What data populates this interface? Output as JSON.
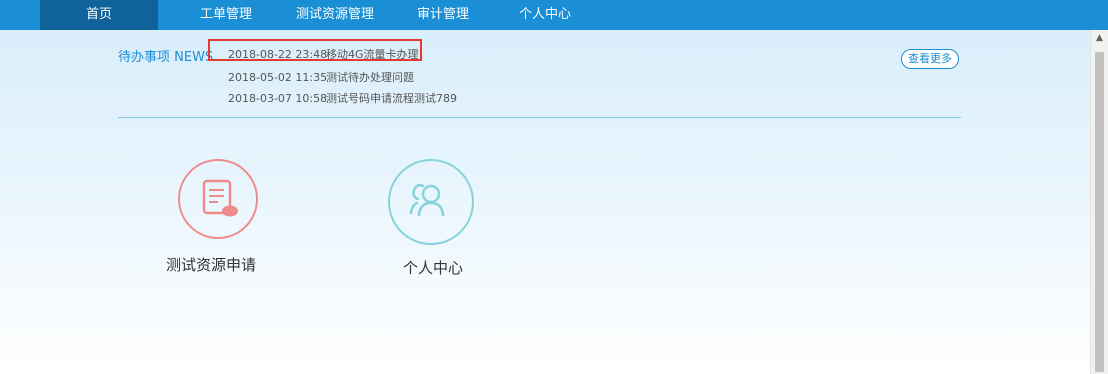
{
  "nav": {
    "items": [
      {
        "label": "首页",
        "active": true
      },
      {
        "label": "工单管理",
        "active": false
      },
      {
        "label": "测试资源管理",
        "active": false
      },
      {
        "label": "审计管理",
        "active": false
      },
      {
        "label": "个人中心",
        "active": false
      }
    ]
  },
  "news": {
    "title": "待办事项 NEWS",
    "items": [
      {
        "date": "2018-08-22 23:48",
        "text": "移动4G流量卡办理"
      },
      {
        "date": "2018-05-02 11:35",
        "text": "测试待办处理问题"
      },
      {
        "date": "2018-03-07 10:58",
        "text": "测试号码申请流程测试789"
      }
    ],
    "more_label": "查看更多"
  },
  "tiles": [
    {
      "label": "测试资源申请",
      "icon": "document-apply-icon",
      "color": "#f08b8b"
    },
    {
      "label": "个人中心",
      "icon": "users-icon",
      "color": "#86d3da"
    }
  ],
  "colors": {
    "nav_bg": "#1a8fd6",
    "nav_active": "#10629a",
    "highlight": "#e53935"
  }
}
